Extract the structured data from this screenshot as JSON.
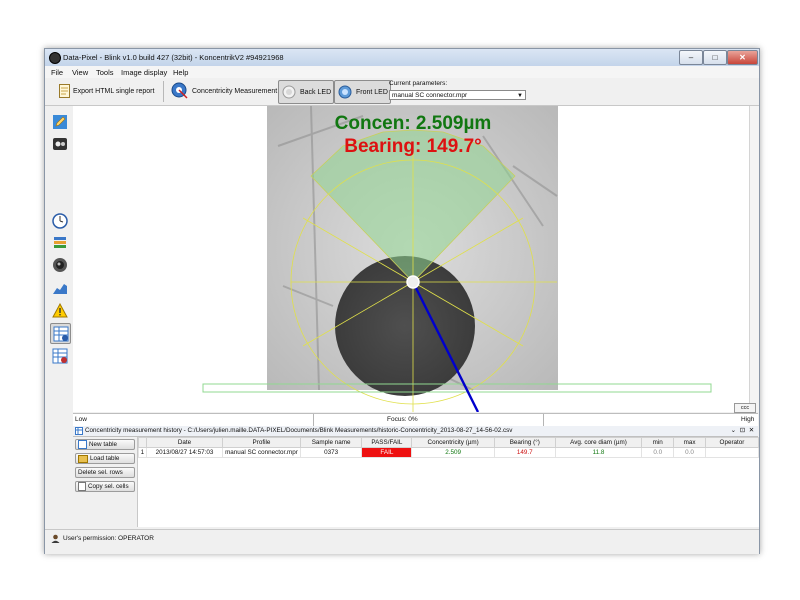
{
  "window": {
    "title": "Data-Pixel - Blink v1.0 build 427 (32bit) - KoncentrikV2 #94921968",
    "controls": {
      "minimize": "–",
      "maximize": "□",
      "close": "✕"
    }
  },
  "menu": [
    "File",
    "View",
    "Tools",
    "Image display",
    "Help"
  ],
  "toolbar": {
    "export_html": "Export HTML single report",
    "concentricity": "Concentricity Measurement",
    "back_led": "Back LED",
    "front_led": "Front LED",
    "current_params_label": "Current parameters:",
    "current_params_value": "manual SC connector.mpr"
  },
  "sidebar_icons": [
    "pencil-icon",
    "video-icon",
    "clock-icon",
    "stack-icon",
    "camera-icon",
    "chart-icon",
    "warning-icon",
    "table-icon",
    "table-settings-icon"
  ],
  "image": {
    "concen_text": "Concen: 2.509µm",
    "bearing_text": "Bearing: 149.7°",
    "colors": {
      "concen": "#117711",
      "bearing": "#dd1111",
      "overlay": "#e0e04a",
      "sector": "#8fd68f",
      "vector": "#0000cc"
    }
  },
  "focus": {
    "low": "Low",
    "focus": "Focus: 0%",
    "high": "High",
    "ccc": "ccc"
  },
  "history_panel": {
    "title": "Concentricity measurement history - C:/Users/julien.maille.DATA-PIXEL/Documents/Blink Measurements/historic-Concentricity_2013-08-27_14-56-02.csv",
    "controls": "⌄ ⊡ ✕",
    "buttons": {
      "new_table": "New table",
      "load_table": "Load table",
      "delete_rows": "Delete sel. rows",
      "copy_cells": "Copy sel. cells"
    },
    "columns": [
      "",
      "Date",
      "Profile",
      "Sample name",
      "PASS/FAIL",
      "Concentricity (µm)",
      "Bearing (°)",
      "Avg. core diam (µm)",
      "min",
      "max",
      "Operator"
    ],
    "rows": [
      {
        "index": "1",
        "date": "2013/08/27 14:57:03",
        "profile": "manual SC connector.mpr",
        "sample": "0373",
        "result": "FAIL",
        "concentricity": "2.509",
        "bearing": "149.7",
        "avg_core": "11.8",
        "min": "0.0",
        "max": "0.0",
        "operator": ""
      }
    ]
  },
  "status": {
    "permission": "User's permission: OPERATOR"
  }
}
